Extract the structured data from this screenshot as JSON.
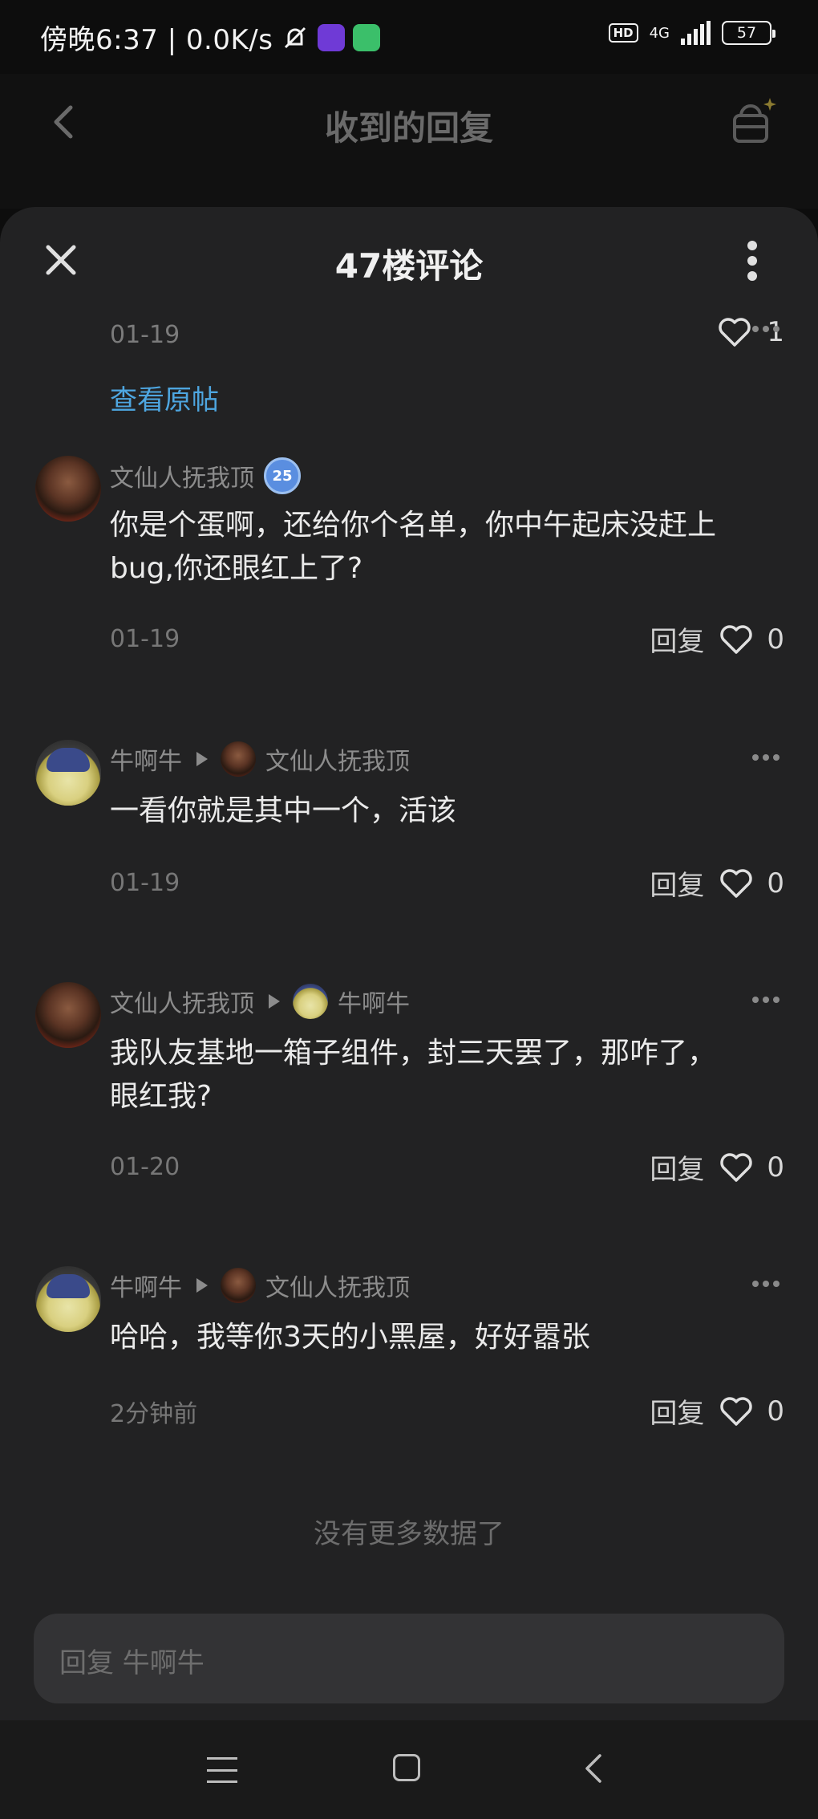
{
  "status_bar": {
    "time_text": "傍晚6:37 | 0.0K/s",
    "hd": "HD",
    "network": "4G",
    "battery": "57"
  },
  "background_page": {
    "title": "收到的回复"
  },
  "sheet": {
    "title": "47楼评论",
    "top_date": "01-19",
    "top_likes": "1",
    "view_original": "查看原帖"
  },
  "comments": [
    {
      "author": "文仙人抚我顶",
      "level_badge": "25",
      "text_line1": "你是个蛋啊，还给你个名单，你中午起床没赶上",
      "text_line2": "bug,你还眼红上了?",
      "date": "01-19",
      "reply_label": "回复",
      "likes": "0"
    },
    {
      "author": "牛啊牛",
      "reply_to": "文仙人抚我顶",
      "text_line1": "一看你就是其中一个，活该",
      "date": "01-19",
      "reply_label": "回复",
      "likes": "0"
    },
    {
      "author": "文仙人抚我顶",
      "reply_to": "牛啊牛",
      "text_line1": "我队友基地一箱子组件，封三天罢了，那咋了，",
      "text_line2": "眼红我?",
      "date": "01-20",
      "reply_label": "回复",
      "likes": "0"
    },
    {
      "author": "牛啊牛",
      "reply_to": "文仙人抚我顶",
      "text_line1": "哈哈，我等你3天的小黑屋，好好嚣张",
      "date": "2分钟前",
      "reply_label": "回复",
      "likes": "0"
    }
  ],
  "footer": {
    "no_more": "没有更多数据了",
    "input_placeholder": "回复 牛啊牛"
  },
  "icons": {
    "heart": "heart-icon",
    "close": "close-icon",
    "more": "more-icon",
    "back": "back-arrow-icon",
    "basket": "basket-icon"
  }
}
